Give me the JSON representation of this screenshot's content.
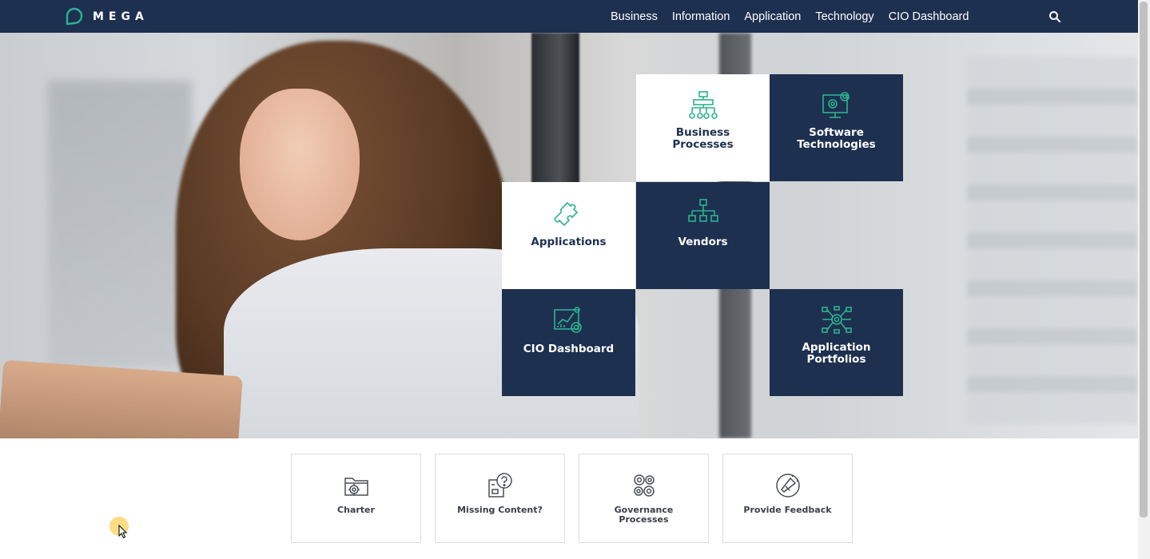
{
  "brand": {
    "name": "MEGA",
    "accent": "#2bb38e",
    "navy": "#1e3050"
  },
  "nav": {
    "items": [
      {
        "label": "Business"
      },
      {
        "label": "Information"
      },
      {
        "label": "Application"
      },
      {
        "label": "Technology"
      },
      {
        "label": "CIO Dashboard"
      }
    ],
    "search_icon": "search-icon"
  },
  "tiles": [
    {
      "label": "Business Processes",
      "style": "light",
      "icon": "org-chart-icon"
    },
    {
      "label": "Software Technologies",
      "style": "dark",
      "icon": "monitor-gear-icon"
    },
    {
      "label": "Applications",
      "style": "light",
      "icon": "puzzle-icon"
    },
    {
      "label": "Vendors",
      "style": "dark",
      "icon": "hierarchy-icon"
    },
    {
      "label": "CIO Dashboard",
      "style": "dark",
      "icon": "chart-gear-icon"
    },
    {
      "label": "Application Portfolios",
      "style": "dark",
      "icon": "network-gear-icon"
    }
  ],
  "cards": [
    {
      "label": "Charter",
      "icon": "folder-gear-icon"
    },
    {
      "label": "Missing Content?",
      "icon": "question-document-icon"
    },
    {
      "label": "Governance Processes",
      "icon": "gears-icon"
    },
    {
      "label": "Provide Feedback",
      "icon": "megaphone-icon"
    }
  ]
}
